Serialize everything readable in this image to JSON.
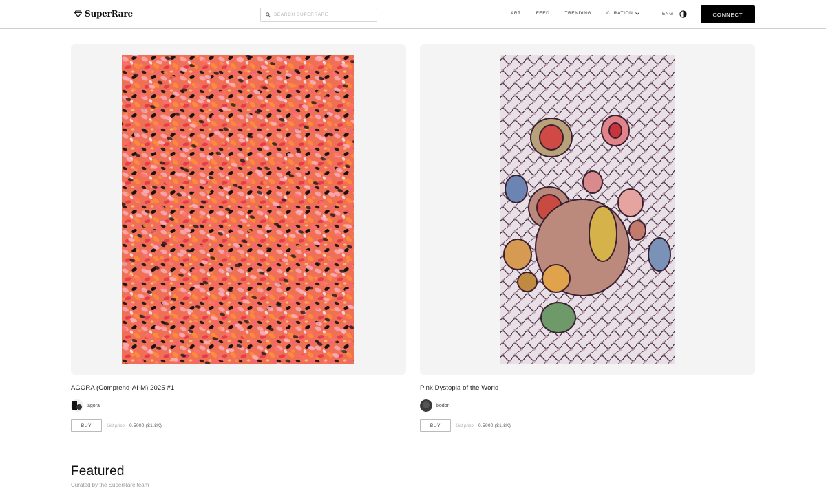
{
  "nav": {
    "brand": "SuperRare",
    "search_placeholder": "SEARCH SUPERRARE",
    "links": [
      "ART",
      "FEED",
      "TRENDING",
      "CURATION"
    ],
    "lang": "ENG",
    "connect_label": "CONNECT"
  },
  "cards": [
    {
      "title": "AGORA (Comprend-AI-M) 2025 #1",
      "artist": "agora",
      "buy_label": "BUY",
      "price_label": "List price",
      "price_value": "0.5000 ($1.8K)"
    },
    {
      "title": "Pink Dystopia of the World",
      "artist": "bodon",
      "buy_label": "BUY",
      "price_label": "List price",
      "price_value": "0.5000 ($1.8K)"
    }
  ],
  "featured": {
    "title": "Featured",
    "subtitle": "Curated by the SuperRare team"
  }
}
